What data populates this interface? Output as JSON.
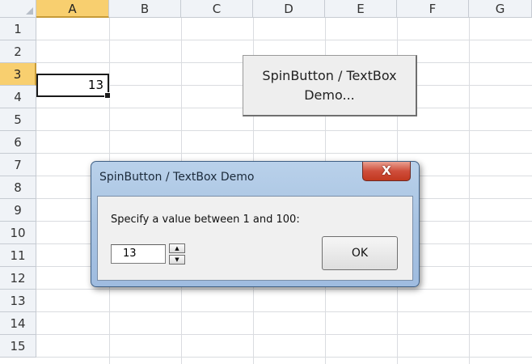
{
  "columns": [
    "A",
    "B",
    "C",
    "D",
    "E",
    "F",
    "G"
  ],
  "rows": [
    "1",
    "2",
    "3",
    "4",
    "5",
    "6",
    "7",
    "8",
    "9",
    "10",
    "11",
    "12",
    "13",
    "14",
    "15"
  ],
  "active_cell": {
    "column": "A",
    "row": "3",
    "value": "13"
  },
  "sheet_button": {
    "label": "SpinButton / TextBox Demo..."
  },
  "dialog": {
    "title": "SpinButton / TextBox Demo",
    "prompt": "Specify a value between 1 and 100:",
    "textbox_value": "13",
    "ok_label": "OK",
    "close_symbol": "X",
    "spin_up_icon": "triangle-up",
    "spin_down_icon": "triangle-down"
  },
  "colors": {
    "header_highlight": "#f8cf6f",
    "dialog_frame": "#a8c3e2",
    "close_button": "#cf4e3b"
  }
}
